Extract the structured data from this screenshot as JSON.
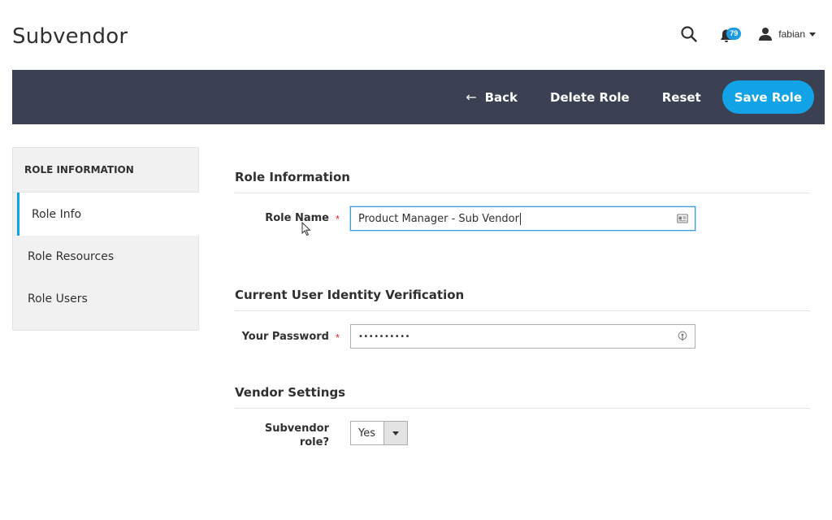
{
  "header": {
    "title": "Subvendor",
    "notification_count": "79",
    "user_name": "fabian"
  },
  "toolbar": {
    "back_label": "Back",
    "back_arrow": "←",
    "delete_label": "Delete Role",
    "reset_label": "Reset",
    "save_label": "Save Role",
    "bg_color": "#3b4053",
    "primary_color": "#12a3e6"
  },
  "sidebar": {
    "heading": "ROLE INFORMATION",
    "items": [
      {
        "label": "Role Info",
        "active": true
      },
      {
        "label": "Role Resources",
        "active": false
      },
      {
        "label": "Role Users",
        "active": false
      }
    ]
  },
  "sections": {
    "role_info": {
      "title": "Role Information",
      "role_name_label": "Role Name",
      "role_name_value": "Product Manager - Sub Vendor"
    },
    "identity": {
      "title": "Current User Identity Verification",
      "password_label": "Your Password",
      "password_value": "••••••••••"
    },
    "vendor": {
      "title": "Vendor Settings",
      "subvendor_label_line1": "Subvendor",
      "subvendor_label_line2": "role?",
      "subvendor_value": "Yes"
    }
  },
  "required_mark": "*",
  "icons": [
    "search-icon",
    "bell-icon",
    "user-icon",
    "contact-card-icon",
    "key-icon",
    "mouse-pointer-icon"
  ]
}
